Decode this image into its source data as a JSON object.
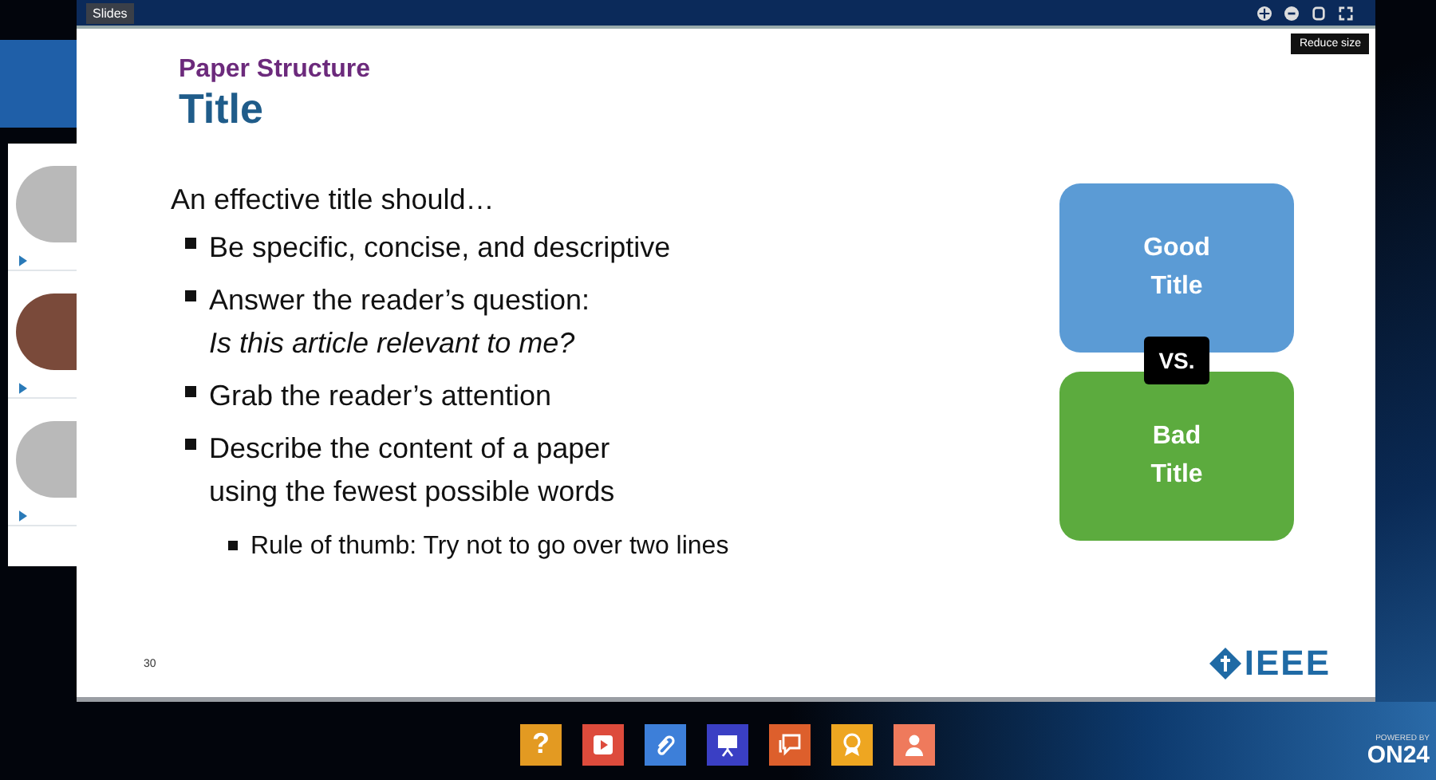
{
  "window": {
    "title": "Slides",
    "tooltip": "Reduce size"
  },
  "slide": {
    "section": "Paper Structure",
    "title": "Title",
    "intro": "An effective title should…",
    "bullets": [
      {
        "lines": [
          "Be specific, concise, and descriptive"
        ]
      },
      {
        "lines": [
          "Answer the reader’s question:"
        ],
        "question": "Is this article relevant to me?"
      },
      {
        "lines": [
          "Grab the reader’s attention"
        ]
      },
      {
        "lines": [
          "Describe the content of a paper",
          "using the fewest possible words"
        ],
        "children": [
          {
            "lines": [
              "Rule of thumb: Try not to go over two lines"
            ]
          }
        ]
      }
    ],
    "comparison": {
      "good": [
        "Good",
        "Title"
      ],
      "versus": "VS.",
      "bad": [
        "Bad",
        "Title"
      ]
    },
    "page_number": "30",
    "logo": "IEEE"
  },
  "toolbar": [
    {
      "kind": "help",
      "label": "?",
      "color": "#e39a22"
    },
    {
      "kind": "media",
      "color": "#dd4b3c"
    },
    {
      "kind": "resources",
      "color": "#3d7fd9"
    },
    {
      "kind": "slides",
      "color": "#3a3fc4"
    },
    {
      "kind": "qa",
      "color": "#dd5f2c"
    },
    {
      "kind": "certificate",
      "color": "#eea621"
    },
    {
      "kind": "speaker",
      "color": "#ef7a5c"
    }
  ],
  "brand": {
    "powered": "POWERED BY",
    "name": "ON24"
  }
}
